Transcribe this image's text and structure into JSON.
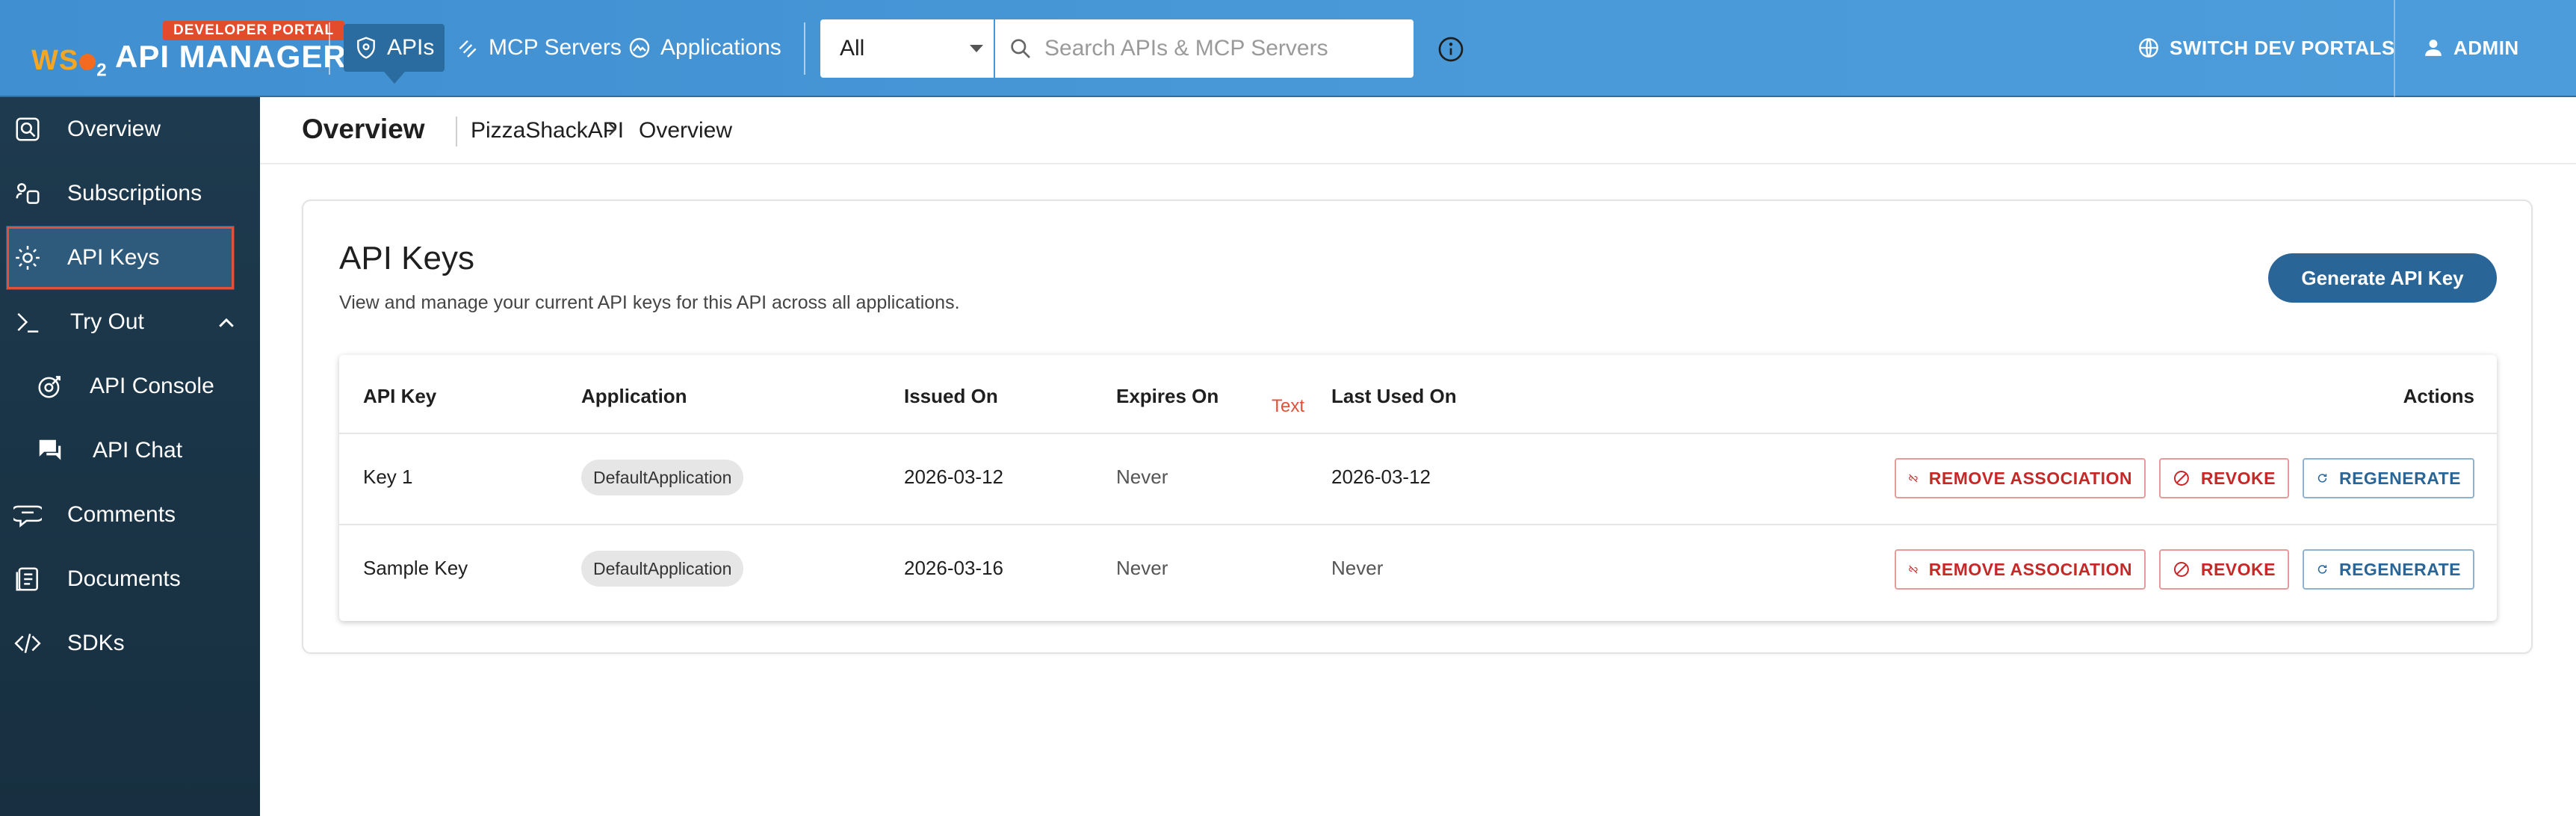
{
  "header": {
    "badge": "DEVELOPER PORTAL",
    "logo_prefix": "WS",
    "logo_suffix": "2",
    "product": "API MANAGER",
    "nav": [
      {
        "label": "APIs",
        "icon": "api-icon",
        "active": true
      },
      {
        "label": "MCP Servers",
        "icon": "mcp-icon",
        "active": false
      },
      {
        "label": "Applications",
        "icon": "applications-icon",
        "active": false
      }
    ],
    "filter_value": "All",
    "search_placeholder": "Search APIs & MCP Servers",
    "switch_portals": "SWITCH DEV PORTALS",
    "user": "ADMIN"
  },
  "sidebar": {
    "items": [
      {
        "label": "Overview",
        "icon": "overview-icon"
      },
      {
        "label": "Subscriptions",
        "icon": "subscriptions-icon"
      },
      {
        "label": "API Keys",
        "icon": "gear-icon",
        "active": true
      },
      {
        "label": "Try Out",
        "icon": "terminal-icon",
        "expanded": true
      },
      {
        "label": "API Console",
        "icon": "console-icon"
      },
      {
        "label": "API Chat",
        "icon": "chat-icon"
      },
      {
        "label": "Comments",
        "icon": "comments-icon"
      },
      {
        "label": "Documents",
        "icon": "documents-icon"
      },
      {
        "label": "SDKs",
        "icon": "code-icon"
      }
    ]
  },
  "breadcrumb": {
    "title": "Overview",
    "api": "PizzaShackAPI",
    "current": "Overview"
  },
  "card": {
    "title": "API Keys",
    "subtitle": "View and manage your current API keys for this API across all applications.",
    "generate_label": "Generate API Key"
  },
  "table": {
    "columns": [
      "API Key",
      "Application",
      "Issued On",
      "Expires On",
      "Last Used On",
      "Actions"
    ],
    "rows": [
      {
        "key": "Key 1",
        "application": "DefaultApplication",
        "issued": "2026-03-12",
        "expires": "Never",
        "last_used": "2026-03-12"
      },
      {
        "key": "Sample Key",
        "application": "DefaultApplication",
        "issued": "2026-03-16",
        "expires": "Never",
        "last_used": "Never"
      }
    ],
    "actions": {
      "remove": "REMOVE ASSOCIATION",
      "revoke": "REVOKE",
      "regenerate": "REGENERATE"
    }
  },
  "annotation_text": "Text",
  "colors": {
    "topbar": "#4a9ad9",
    "sidebar": "#1e3a4e",
    "primary": "#2a6597",
    "danger": "#c62828",
    "highlight": "#e0503a"
  }
}
